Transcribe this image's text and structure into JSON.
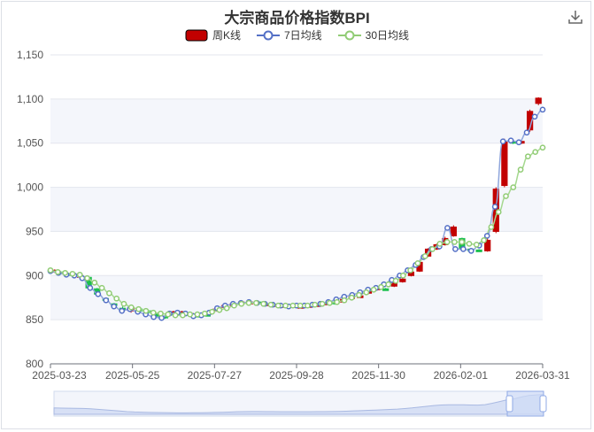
{
  "chart_data": {
    "type": "candlestick",
    "title": "大宗商品价格指数BPI",
    "legend": [
      "周K线",
      "7日均线",
      "30日均线"
    ],
    "xlabel": "",
    "ylabel": "",
    "ylim": [
      800,
      1150
    ],
    "yticks": [
      "800",
      "850",
      "900",
      "950",
      "1,000",
      "1,050",
      "1,100",
      "1,150"
    ],
    "xticks": [
      "2025-03-23",
      "2025-05-25",
      "2025-07-27",
      "2025-09-28",
      "2025-11-30",
      "2026-02-01",
      "2026-03-31"
    ],
    "grid": true,
    "colors": {
      "up": "#c20000",
      "down": "#1bbf4e",
      "ma7": "#5470c6",
      "ma30": "#91cc75"
    },
    "candles": [
      {
        "o": 905,
        "c": 906,
        "l": 903,
        "h": 907
      },
      {
        "o": 904,
        "c": 903,
        "l": 901,
        "h": 905
      },
      {
        "o": 902,
        "c": 901,
        "l": 899,
        "h": 903
      },
      {
        "o": 900,
        "c": 900,
        "l": 898,
        "h": 902
      },
      {
        "o": 898,
        "c": 886,
        "l": 884,
        "h": 899
      },
      {
        "o": 885,
        "c": 879,
        "l": 877,
        "h": 886
      },
      {
        "o": 874,
        "c": 872,
        "l": 870,
        "h": 875
      },
      {
        "o": 868,
        "c": 866,
        "l": 864,
        "h": 869
      },
      {
        "o": 863,
        "c": 861,
        "l": 859,
        "h": 865
      },
      {
        "o": 860,
        "c": 864,
        "l": 858,
        "h": 865
      },
      {
        "o": 862,
        "c": 861,
        "l": 860,
        "h": 863
      },
      {
        "o": 860,
        "c": 858,
        "l": 857,
        "h": 861
      },
      {
        "o": 856,
        "c": 854,
        "l": 852,
        "h": 857
      },
      {
        "o": 854,
        "c": 853,
        "l": 851,
        "h": 855
      },
      {
        "o": 857,
        "c": 859,
        "l": 856,
        "h": 860
      },
      {
        "o": 858,
        "c": 859,
        "l": 857,
        "h": 860
      },
      {
        "o": 856,
        "c": 857,
        "l": 855,
        "h": 858
      },
      {
        "o": 855,
        "c": 854,
        "l": 853,
        "h": 856
      },
      {
        "o": 856,
        "c": 855,
        "l": 854,
        "h": 857
      },
      {
        "o": 860,
        "c": 862,
        "l": 859,
        "h": 863
      },
      {
        "o": 865,
        "c": 866,
        "l": 864,
        "h": 867
      },
      {
        "o": 867,
        "c": 868,
        "l": 866,
        "h": 869
      },
      {
        "o": 869,
        "c": 870,
        "l": 868,
        "h": 871
      },
      {
        "o": 870,
        "c": 870,
        "l": 869,
        "h": 871
      },
      {
        "o": 870,
        "c": 869,
        "l": 868,
        "h": 871
      },
      {
        "o": 868,
        "c": 868,
        "l": 867,
        "h": 869
      },
      {
        "o": 867,
        "c": 867,
        "l": 866,
        "h": 868
      },
      {
        "o": 866,
        "c": 866,
        "l": 865,
        "h": 867
      },
      {
        "o": 866,
        "c": 866,
        "l": 865,
        "h": 867
      },
      {
        "o": 865,
        "c": 865,
        "l": 864,
        "h": 866
      },
      {
        "o": 866,
        "c": 866,
        "l": 865,
        "h": 867
      },
      {
        "o": 866,
        "c": 867,
        "l": 865,
        "h": 868
      },
      {
        "o": 868,
        "c": 869,
        "l": 867,
        "h": 870
      },
      {
        "o": 870,
        "c": 868,
        "l": 867,
        "h": 871
      },
      {
        "o": 870,
        "c": 873,
        "l": 869,
        "h": 874
      },
      {
        "o": 875,
        "c": 876,
        "l": 874,
        "h": 877
      },
      {
        "o": 877,
        "c": 877,
        "l": 876,
        "h": 878
      },
      {
        "o": 880,
        "c": 883,
        "l": 879,
        "h": 884
      },
      {
        "o": 884,
        "c": 886,
        "l": 883,
        "h": 887
      },
      {
        "o": 885,
        "c": 884,
        "l": 883,
        "h": 886
      },
      {
        "o": 888,
        "c": 893,
        "l": 887,
        "h": 894
      },
      {
        "o": 893,
        "c": 896,
        "l": 892,
        "h": 897
      },
      {
        "o": 900,
        "c": 904,
        "l": 899,
        "h": 905
      },
      {
        "o": 905,
        "c": 915,
        "l": 904,
        "h": 916
      },
      {
        "o": 922,
        "c": 930,
        "l": 921,
        "h": 931
      },
      {
        "o": 930,
        "c": 935,
        "l": 929,
        "h": 936
      },
      {
        "o": 935,
        "c": 942,
        "l": 934,
        "h": 944
      },
      {
        "o": 945,
        "c": 955,
        "l": 944,
        "h": 957
      },
      {
        "o": 942,
        "c": 930,
        "l": 928,
        "h": 943
      },
      {
        "o": 930,
        "c": 929,
        "l": 927,
        "h": 931
      },
      {
        "o": 929,
        "c": 928,
        "l": 927,
        "h": 930
      },
      {
        "o": 928,
        "c": 940,
        "l": 927,
        "h": 942
      },
      {
        "o": 950,
        "c": 998,
        "l": 948,
        "h": 1000
      },
      {
        "o": 1002,
        "c": 1052,
        "l": 1000,
        "h": 1055
      },
      {
        "o": 1052,
        "c": 1051,
        "l": 1049,
        "h": 1053
      },
      {
        "o": 1050,
        "c": 1052,
        "l": 1049,
        "h": 1054
      },
      {
        "o": 1065,
        "c": 1086,
        "l": 1063,
        "h": 1088
      },
      {
        "o": 1095,
        "c": 1101,
        "l": 1093,
        "h": 1102
      }
    ],
    "ma7": [
      905,
      903,
      901,
      900,
      897,
      886,
      879,
      872,
      865,
      860,
      862,
      859,
      856,
      853,
      852,
      857,
      858,
      857,
      854,
      855,
      858,
      863,
      866,
      868,
      869,
      870,
      869,
      868,
      867,
      866,
      865,
      866,
      866,
      867,
      868,
      870,
      873,
      876,
      878,
      881,
      884,
      886,
      890,
      895,
      900,
      906,
      912,
      921,
      930,
      933,
      954,
      930,
      930,
      928,
      934,
      945,
      978,
      1052,
      1053,
      1051,
      1062,
      1080,
      1088
    ],
    "ma30": [
      906,
      904,
      903,
      902,
      901,
      897,
      892,
      886,
      880,
      874,
      868,
      864,
      862,
      860,
      858,
      857,
      856,
      855,
      855,
      856,
      856,
      857,
      859,
      861,
      863,
      866,
      868,
      869,
      869,
      868,
      867,
      866,
      866,
      866,
      866,
      866,
      867,
      868,
      869,
      870,
      872,
      875,
      878,
      881,
      884,
      887,
      890,
      894,
      900,
      906,
      914,
      922,
      930,
      936,
      938,
      938,
      938,
      936,
      935,
      940,
      955,
      972,
      990,
      1000,
      1020,
      1035,
      1040,
      1045
    ]
  }
}
